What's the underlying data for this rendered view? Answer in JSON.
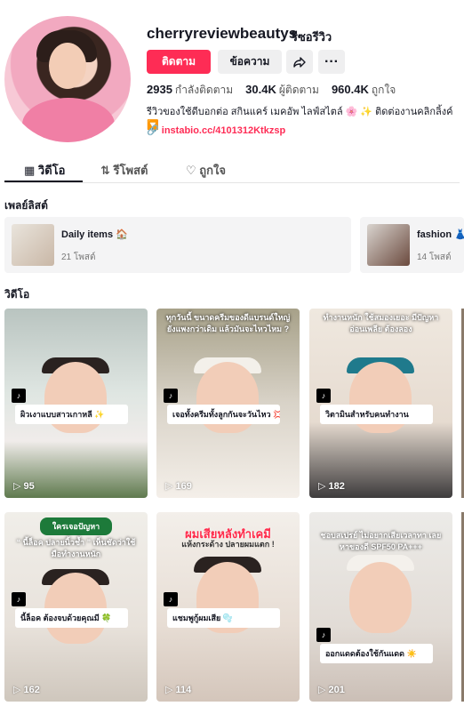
{
  "profile": {
    "username": "cherryreviewbeautys",
    "nickname": "รีซอรีวิว",
    "follow_label": "ติดตาม",
    "message_label": "ข้อความ",
    "following_count": "2935",
    "following_label": "กำลังติดตาม",
    "followers_count": "30.4K",
    "followers_label": "ผู้ติดตาม",
    "likes_count": "960.4K",
    "likes_label": "ถูกใจ",
    "bio": "รีวิวของใช้ดีบอกต่อ สกินแคร์ เมคอัพ ไลฟ์สไตล์ 🌸 ✨ ติดต่องานคลิกลิ้งค์ 🔽",
    "link": "instabio.cc/4101312Ktkzsp"
  },
  "tabs": [
    {
      "label": "วิดีโอ",
      "icon": "grid-icon"
    },
    {
      "label": "รีโพสต์",
      "icon": "repost-icon"
    },
    {
      "label": "ถูกใจ",
      "icon": "heart-icon"
    }
  ],
  "sections": {
    "playlists": "เพลย์ลิสต์",
    "videos": "วิดีโอ"
  },
  "playlists": [
    {
      "name": "Daily items 🏠",
      "count": "21 โพสต์"
    },
    {
      "name": "fashion 👗",
      "count": "14 โพสต์"
    }
  ],
  "videos": [
    {
      "caption": "ผิวเงาแบบสาวเกาหลี ✨",
      "views": "95",
      "overlay": ""
    },
    {
      "caption": "เจอทั้งครีมทั้งลูกกันจะวันไหว 💢",
      "views": "169",
      "overlay": "ทุกวันนี้ ขนาดครีมของดีแบรนด์ใหญ่ ยังแพงกว่าเดิม แล้วมันจะไหวไหม ?"
    },
    {
      "caption": "วิตามินสำหรับคนทำงาน",
      "views": "182",
      "overlay": "ทำงานหนัก ใช้สมองเยอะ มีปัญหาอ่อนเพลีย ต้องลอง"
    },
    {
      "caption": "นี้ล็อค ต้องจบด้วยคุณมี 🍀",
      "views": "162",
      "overlay": "“ นี้ล็อค ปลายนิ้วช้ำ ” เห็นชัดว่าใช้มือทำงานหนัก",
      "banner": "ใครเจอปัญหา"
    },
    {
      "caption": "แชมพูกู้ผมเสีย 🫧",
      "views": "114",
      "overlay": "แห้งกระด้าง ปลายผมแตก !",
      "title": "ผมเสียหลังทำเคมี"
    },
    {
      "caption": "ออกแดดต้องใช้กันแดด ☀️",
      "views": "201",
      "overlay": "ชอบสเปรย์ ไม่อยากเสียเวลาทา เลยหาของดี SPF50 PA+++"
    }
  ],
  "colors": {
    "accent": "#fe2c55",
    "text": "#161823"
  }
}
